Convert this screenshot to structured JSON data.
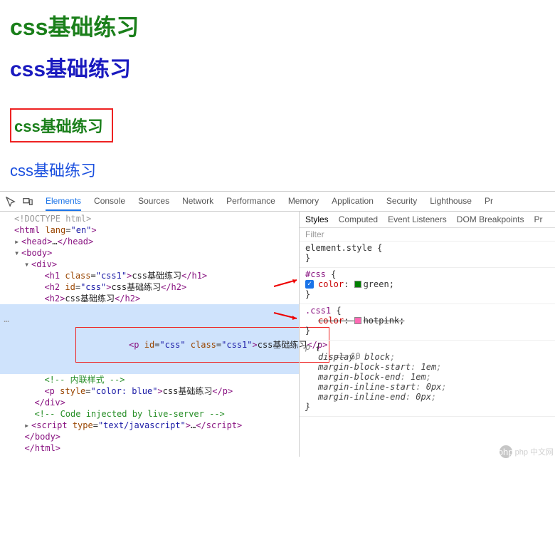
{
  "page": {
    "h1": "css基础练习",
    "h2": "css基础练习",
    "h3": "css基础练习",
    "p": "css基础练习"
  },
  "toolbar": {
    "tabs": [
      "Elements",
      "Console",
      "Sources",
      "Network",
      "Performance",
      "Memory",
      "Application",
      "Security",
      "Lighthouse",
      "Pr"
    ]
  },
  "elements": {
    "doctype": "<!DOCTYPE html>",
    "html_open": {
      "tag": "html",
      "attrs": [
        [
          "lang",
          "en"
        ]
      ]
    },
    "head": {
      "tag": "head",
      "collapsed": "…"
    },
    "body_open": {
      "tag": "body"
    },
    "div_open": {
      "tag": "div"
    },
    "h1": {
      "tag": "h1",
      "attrs": [
        [
          "class",
          "css1"
        ]
      ],
      "text": "css基础练习"
    },
    "h2a": {
      "tag": "h2",
      "attrs": [
        [
          "id",
          "css"
        ]
      ],
      "text": "css基础练习"
    },
    "h2b": {
      "tag": "h2",
      "text": "css基础练习"
    },
    "selected": {
      "tag": "p",
      "attrs": [
        [
          "id",
          "css"
        ],
        [
          "class",
          "css1"
        ]
      ],
      "text": "css基础练习",
      "suffix": " == $0"
    },
    "comment": "<!-- 内联样式 -->",
    "pstyle": {
      "tag": "p",
      "attrs": [
        [
          "style",
          "color: blue"
        ]
      ],
      "text": "css基础练习"
    },
    "div_close": "</div>",
    "comment2": "<!-- Code injected by live-server -->",
    "script": {
      "tag": "script",
      "attrs": [
        [
          "type",
          "text/javascript"
        ]
      ],
      "collapsed": "…"
    },
    "body_close": "</body>",
    "html_close": "</html>"
  },
  "styles": {
    "sub_tabs": [
      "Styles",
      "Computed",
      "Event Listeners",
      "DOM Breakpoints",
      "Pr"
    ],
    "filter": "Filter",
    "element_style": {
      "selector": "element.style",
      "props": []
    },
    "id_rule": {
      "selector": "#css",
      "props": [
        {
          "name": "color",
          "value": "green",
          "swatch": "#008000",
          "checked": true
        }
      ]
    },
    "class_rule": {
      "selector": ".css1",
      "props": [
        {
          "name": "color",
          "value": "hotpink",
          "swatch": "#ff69b4",
          "strike": true
        }
      ]
    },
    "p_rule": {
      "selector": "p",
      "italic": true,
      "props": [
        {
          "name": "display",
          "value": "block"
        },
        {
          "name": "margin-block-start",
          "value": "1em"
        },
        {
          "name": "margin-block-end",
          "value": "1em"
        },
        {
          "name": "margin-inline-start",
          "value": "0px"
        },
        {
          "name": "margin-inline-end",
          "value": "0px"
        }
      ]
    }
  },
  "watermark": {
    "logo": "php",
    "text": "php 中文网"
  }
}
